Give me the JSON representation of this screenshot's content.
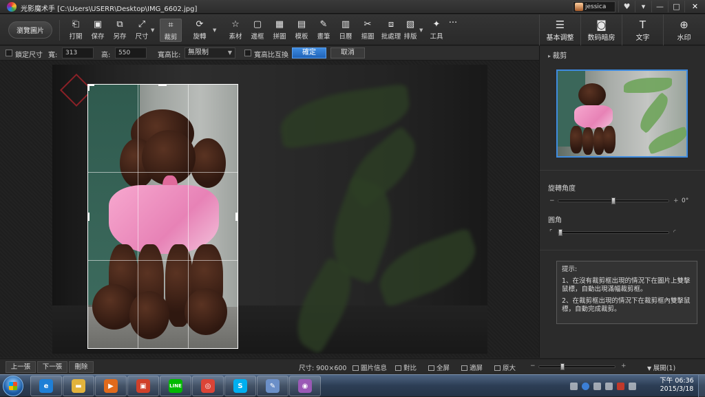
{
  "window": {
    "app_name": "光影魔术手",
    "file_path": "[C:\\Users\\USERR\\Desktop\\IMG_6602.jpg]",
    "user_name": "jessica",
    "buttons": [
      "♥",
      "▾",
      "—",
      "□",
      "✕"
    ]
  },
  "toolbar": {
    "open_label": "瀏覽圖片",
    "tools": [
      {
        "label": "打開",
        "icon": "open-icon",
        "glyph": "⎗"
      },
      {
        "label": "保存",
        "icon": "save-icon",
        "glyph": "▣"
      },
      {
        "label": "另存",
        "icon": "save-as-icon",
        "glyph": "⧉"
      },
      {
        "label": "尺寸",
        "icon": "resize-icon",
        "glyph": "⤢"
      },
      {
        "label": "裁剪",
        "icon": "crop-icon",
        "glyph": "⌗"
      },
      {
        "label": "旋轉",
        "icon": "rotate-icon",
        "glyph": "⟳"
      },
      {
        "label": "素材",
        "icon": "material-icon",
        "glyph": "☆"
      },
      {
        "label": "邊框",
        "icon": "border-icon",
        "glyph": "▢"
      },
      {
        "label": "拼圖",
        "icon": "collage-icon",
        "glyph": "▦"
      },
      {
        "label": "模板",
        "icon": "template-icon",
        "glyph": "▤"
      },
      {
        "label": "畫筆",
        "icon": "brush-icon",
        "glyph": "✎"
      },
      {
        "label": "日曆",
        "icon": "calendar-icon",
        "glyph": "▥"
      },
      {
        "label": "摳圖",
        "icon": "cutout-icon",
        "glyph": "✂"
      },
      {
        "label": "批處理",
        "icon": "batch-icon",
        "glyph": "⧈"
      },
      {
        "label": "排版",
        "icon": "layout-icon",
        "glyph": "▧"
      },
      {
        "label": "工具",
        "icon": "tools-icon",
        "glyph": "✦"
      }
    ],
    "more": "···"
  },
  "right_tabs": [
    {
      "label": "基本调整",
      "icon": "basic-adjust-icon",
      "glyph": "☰"
    },
    {
      "label": "数码暗房",
      "icon": "darkroom-icon",
      "glyph": "◙"
    },
    {
      "label": "文字",
      "icon": "text-icon",
      "glyph": "T"
    },
    {
      "label": "水印",
      "icon": "watermark-icon",
      "glyph": "⊕"
    }
  ],
  "crop_options": {
    "lock_size_label": "鎖定尺寸",
    "width_label": "寬:",
    "width_value": "313",
    "height_label": "高:",
    "height_value": "550",
    "ratio_label": "寬高比:",
    "ratio_value": "無限制",
    "swap_label": "寬高比互換",
    "confirm_label": "確定",
    "cancel_label": "取消"
  },
  "right_panel": {
    "section_title": "裁剪",
    "rotate_label": "旋轉角度",
    "rotate_value": "0°",
    "rotate_level": 0.5,
    "radius_label": "圓角",
    "radius_level": 0.0,
    "tip_title": "提示:",
    "tip_1": "1、在沒有裁剪框出現的情況下在圖片上雙擊鼠標，自動出現滿幅裁剪框。",
    "tip_2": "2、在裁剪框出現的情況下在裁剪框內雙擊鼠標，自動完成裁剪。"
  },
  "status": {
    "prev_label": "上一張",
    "next_label": "下一張",
    "delete_label": "刪除",
    "size_text": "尺寸: 900×600",
    "info_label": "圖片信息",
    "compare_label": "對比",
    "fullscreen_label": "全屏",
    "fit_label": "適屏",
    "original_label": "原大",
    "zoom_level": 0.3,
    "expand_label": "展開(1)"
  },
  "taskbar": {
    "apps": [
      {
        "name": "ie-icon",
        "glyph": "e",
        "color": "#1e7fd6"
      },
      {
        "name": "folder-icon",
        "glyph": "▬",
        "color": "#e2b33c"
      },
      {
        "name": "media-player-icon",
        "glyph": "▶",
        "color": "#e06a1c"
      },
      {
        "name": "gadget-icon",
        "glyph": "▣",
        "color": "#d0402a"
      },
      {
        "name": "line-icon",
        "glyph": "LINE",
        "color": "#00b900"
      },
      {
        "name": "chrome-icon",
        "glyph": "◎",
        "color": "#db4437"
      },
      {
        "name": "skype-icon",
        "glyph": "S",
        "color": "#00aff0"
      },
      {
        "name": "paint-icon",
        "glyph": "✎",
        "color": "#6b8fc8"
      },
      {
        "name": "photo-app-icon",
        "glyph": "◉",
        "color": "#9b59b6"
      }
    ],
    "time": "下午 06:36",
    "date": "2015/3/18"
  }
}
